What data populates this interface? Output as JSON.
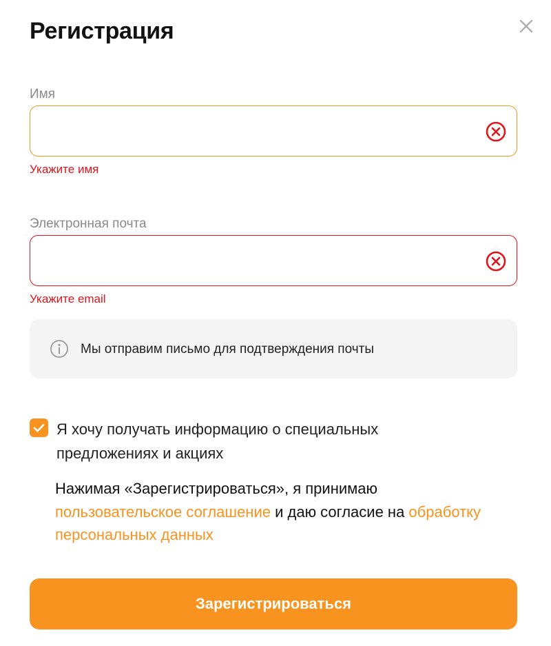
{
  "dialog": {
    "title": "Регистрация",
    "close_icon": "close-icon"
  },
  "name_field": {
    "label": "Имя",
    "value": "",
    "error": "Укажите имя",
    "border_color": "#f29b1f",
    "clear_icon": "clear-x-circle-icon"
  },
  "email_field": {
    "label": "Электронная почта",
    "value": "",
    "error": "Укажите email",
    "border_color": "#e0141b",
    "clear_icon": "clear-x-circle-icon"
  },
  "info": {
    "icon": "info-circle-icon",
    "text": "Мы отправим письмо для подтверждения почты"
  },
  "promo_checkbox": {
    "checked": true,
    "label": "Я хочу получать информацию о специальных предложениях и акциях"
  },
  "agreement": {
    "text_before": "Нажимая «Зарегистрироваться», я принимаю ",
    "link_terms": "пользовательское соглашение",
    "text_middle": " и даю согласие на ",
    "link_privacy": "обработку персональных данных"
  },
  "submit": {
    "label": "Зарегистрироваться"
  },
  "colors": {
    "accent": "#f7931e",
    "error": "#e0141b",
    "info_bg": "#f4f4f4"
  }
}
